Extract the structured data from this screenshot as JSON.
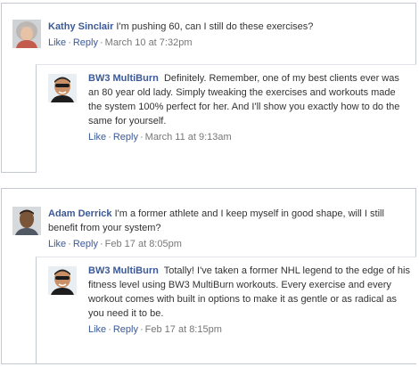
{
  "threads": [
    {
      "comment": {
        "author": "Kathy Sinclair",
        "text": "I'm pushing 60, can I still do these exercises?",
        "like_label": "Like",
        "reply_label": "Reply",
        "separator": "·",
        "timestamp": "March 10 at 7:32pm",
        "avatar_icon": "woman-profile-photo"
      },
      "reply": {
        "author": "BW3 MultiBurn",
        "text": "Definitely. Remember, one of my best clients ever was an 80 year old lady. Simply tweaking the exercises and workouts made the system 100% perfect for her. And I'll show you exactly how to do the same for yourself.",
        "like_label": "Like",
        "reply_label": "Reply",
        "separator": "·",
        "timestamp": "March 11 at 9:13am",
        "avatar_icon": "man-sunglasses-profile-photo"
      }
    },
    {
      "comment": {
        "author": "Adam Derrick",
        "text": "I'm a former athlete and I keep myself in good shape, will I still benefit from your system?",
        "like_label": "Like",
        "reply_label": "Reply",
        "separator": "·",
        "timestamp": "Feb 17 at 8:05pm",
        "avatar_icon": "man-profile-photo"
      },
      "reply": {
        "author": "BW3 MultiBurn",
        "text": "Totally! I've taken a former NHL legend to the edge of his fitness level using BW3 MultiBurn workouts. Every exercise and every workout comes with built in options to make it as gentle or as radical as you need it to be.",
        "like_label": "Like",
        "reply_label": "Reply",
        "separator": "·",
        "timestamp": "Feb 17 at 8:15pm",
        "avatar_icon": "man-sunglasses-profile-photo"
      }
    }
  ],
  "colors": {
    "link": "#3b5998",
    "meta": "#777777",
    "border": "#c4c8d0",
    "text": "#333333"
  }
}
